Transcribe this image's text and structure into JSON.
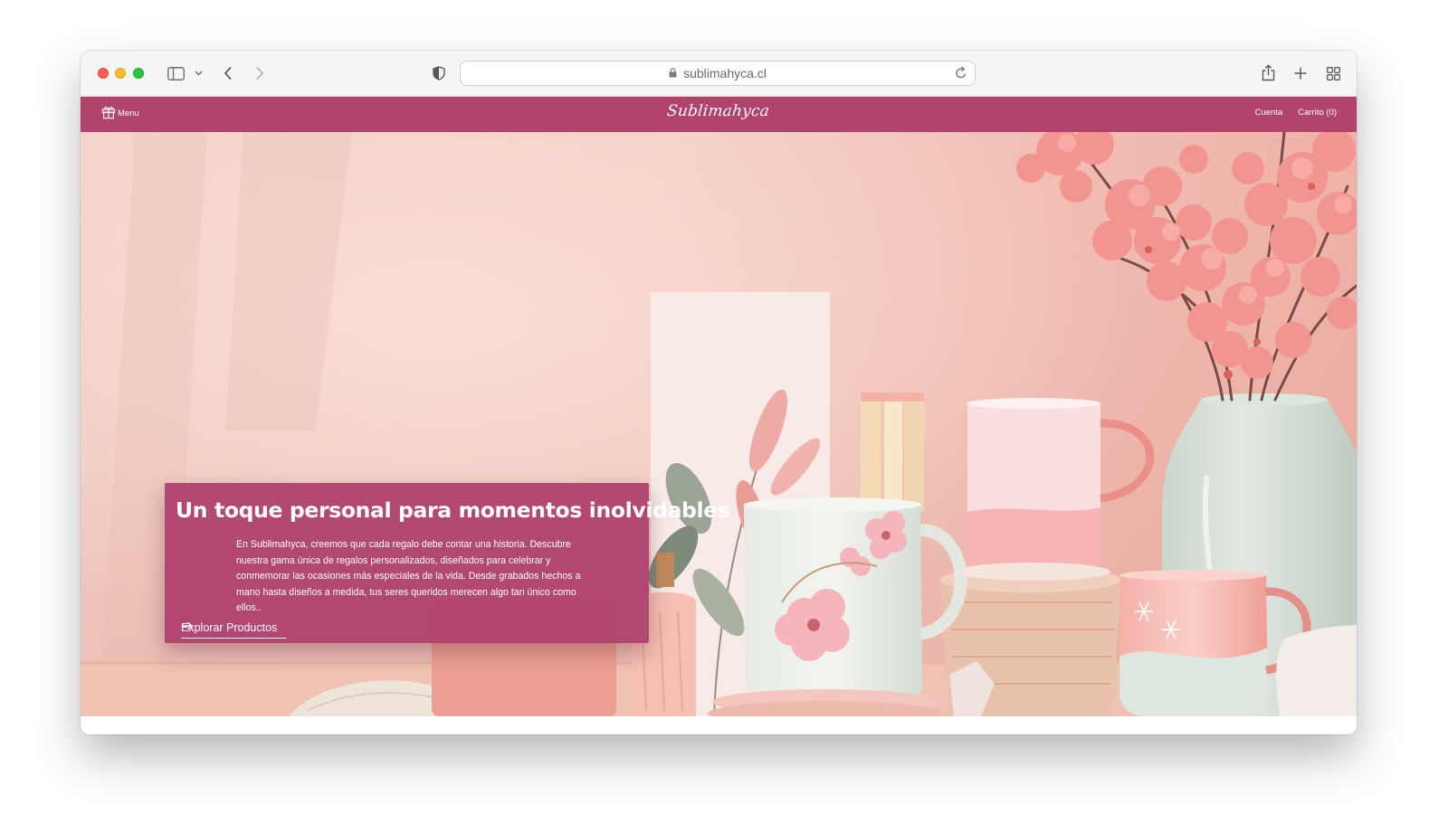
{
  "browser": {
    "url": "sublimahyca.cl",
    "icons": [
      "sidebar-icon",
      "chevron-down-icon",
      "back-icon",
      "forward-icon",
      "shield-icon",
      "lock-icon",
      "reload-icon",
      "share-icon",
      "plus-icon",
      "tabs-grid-icon"
    ]
  },
  "nav": {
    "menu_label": "Menu",
    "logo": "Sublimahyca",
    "account_label": "Cuenta",
    "cart_label": "Carrito (0)"
  },
  "hero": {
    "title": "Un toque personal para momentos inolvidables",
    "text": "En Sublimahyca, creemos que cada regalo debe contar una historia. Descubre nuestra gama única de regalos personalizados, diseñados para celebrar y conmemorar las ocasiones más especiales de la vida. Desde grabados hechos a mano hasta diseños a medida, tus seres queridos merecen algo tan único como ellos..",
    "cta_label": "Explorar Productos"
  },
  "colors": {
    "brand": "#b0446d",
    "card": "#ad3e6a",
    "hero_background": "#f2c3b8"
  }
}
